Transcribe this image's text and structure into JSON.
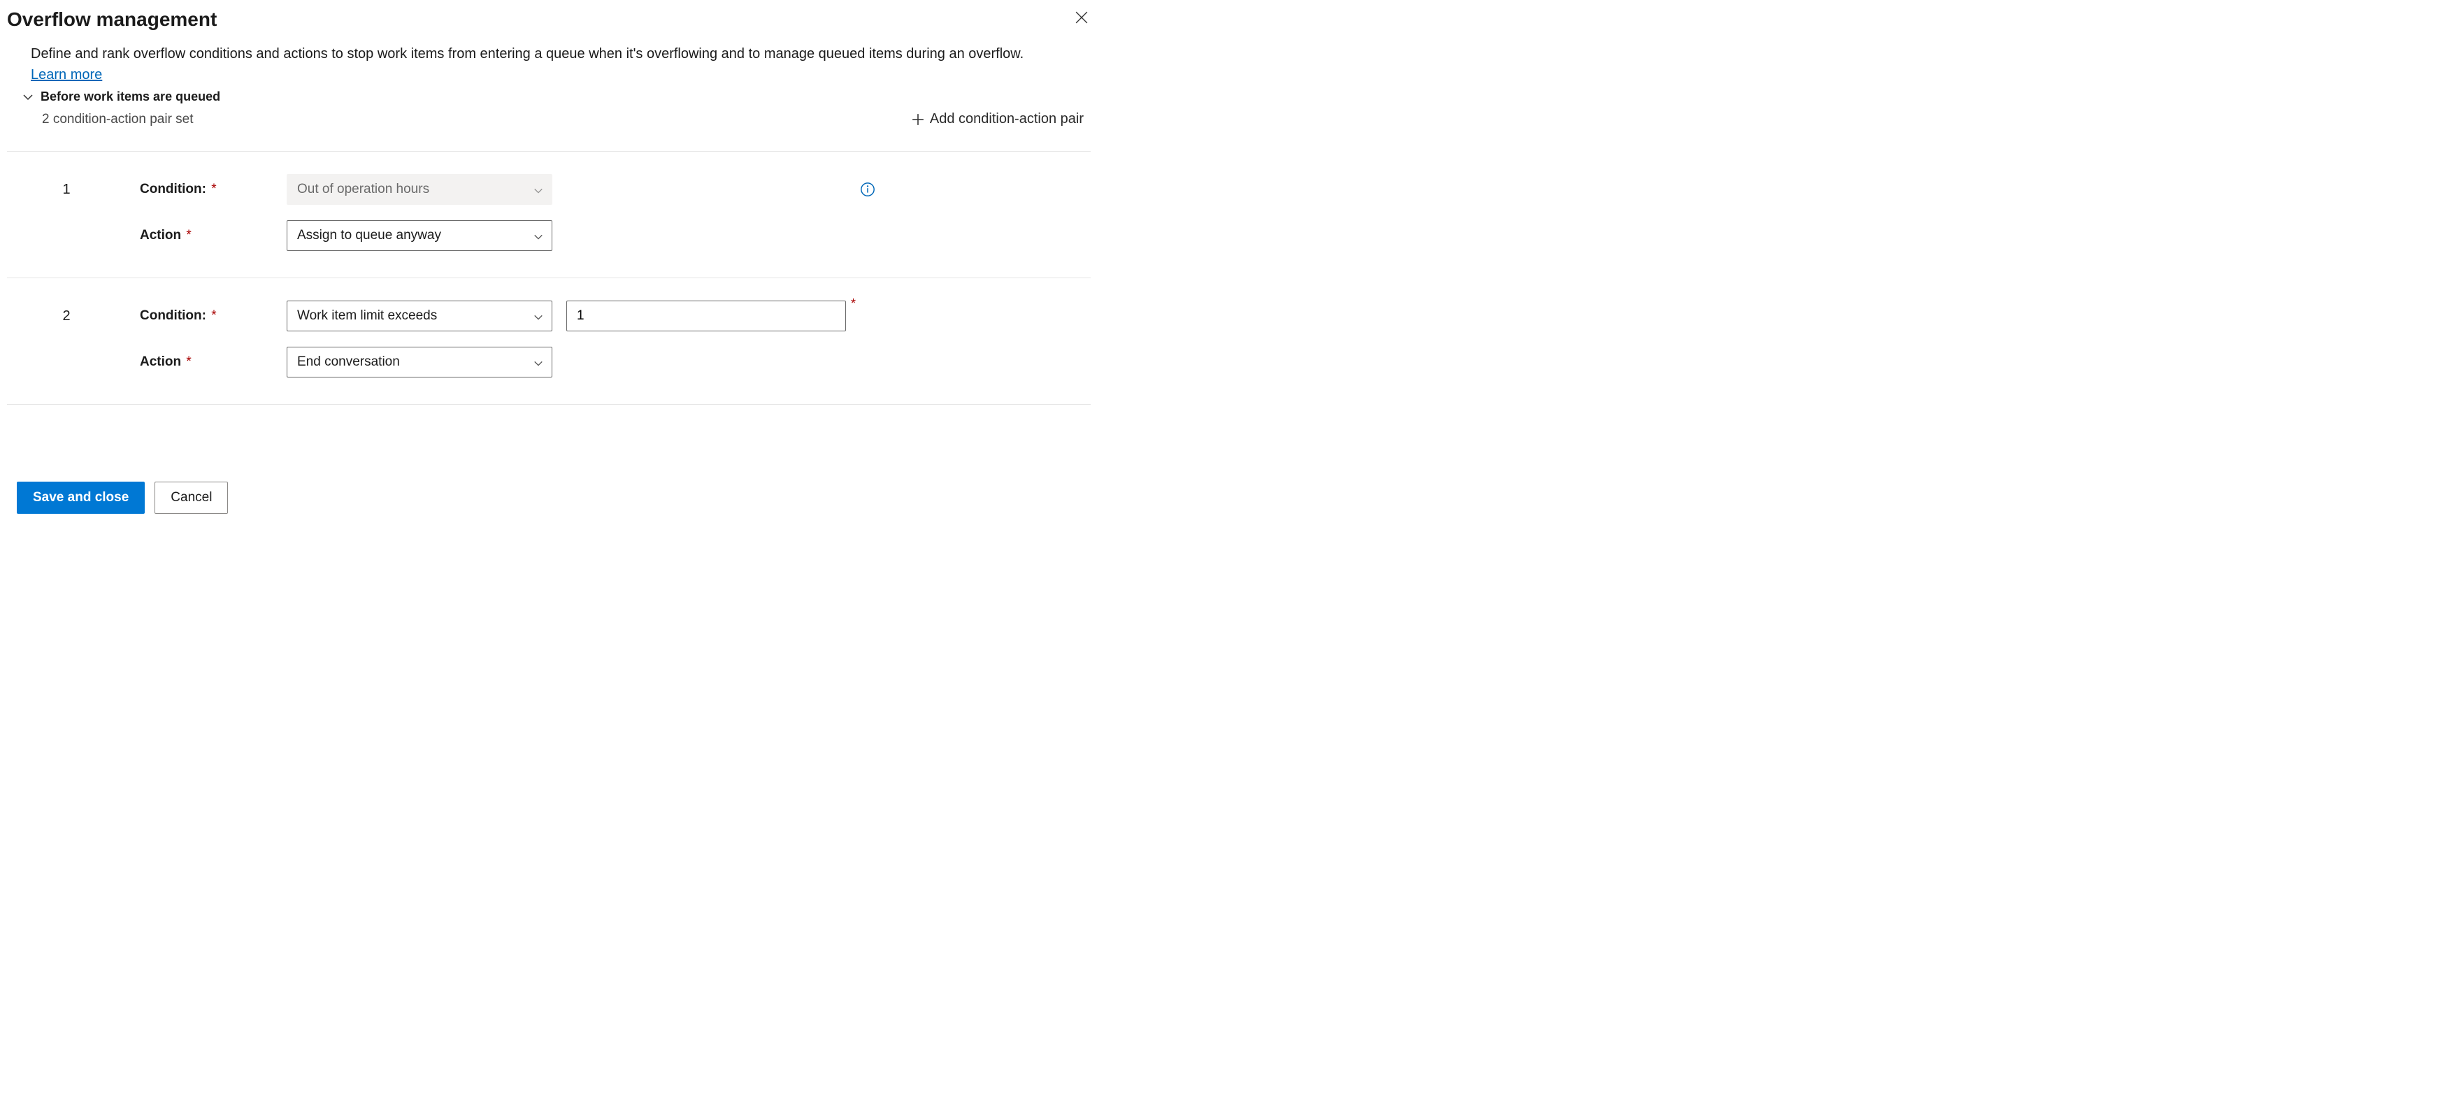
{
  "header": {
    "title": "Overflow management",
    "description": "Define and rank overflow conditions and actions to stop work items from entering a queue when it's overflowing and to manage queued items during an overflow. ",
    "learn_more": "Learn more"
  },
  "section": {
    "title": "Before work items are queued",
    "subtitle": "2 condition-action pair set",
    "add_pair_label": "Add condition-action pair"
  },
  "labels": {
    "condition": "Condition:",
    "action": "Action"
  },
  "pairs": [
    {
      "index": "1",
      "condition_value": "Out of operation hours",
      "condition_disabled": true,
      "show_info": true,
      "action_value": "Assign to queue anyway",
      "extra_input": null
    },
    {
      "index": "2",
      "condition_value": "Work item limit exceeds",
      "condition_disabled": false,
      "show_info": false,
      "action_value": "End conversation",
      "extra_input": "1"
    }
  ],
  "footer": {
    "save": "Save and close",
    "cancel": "Cancel"
  }
}
